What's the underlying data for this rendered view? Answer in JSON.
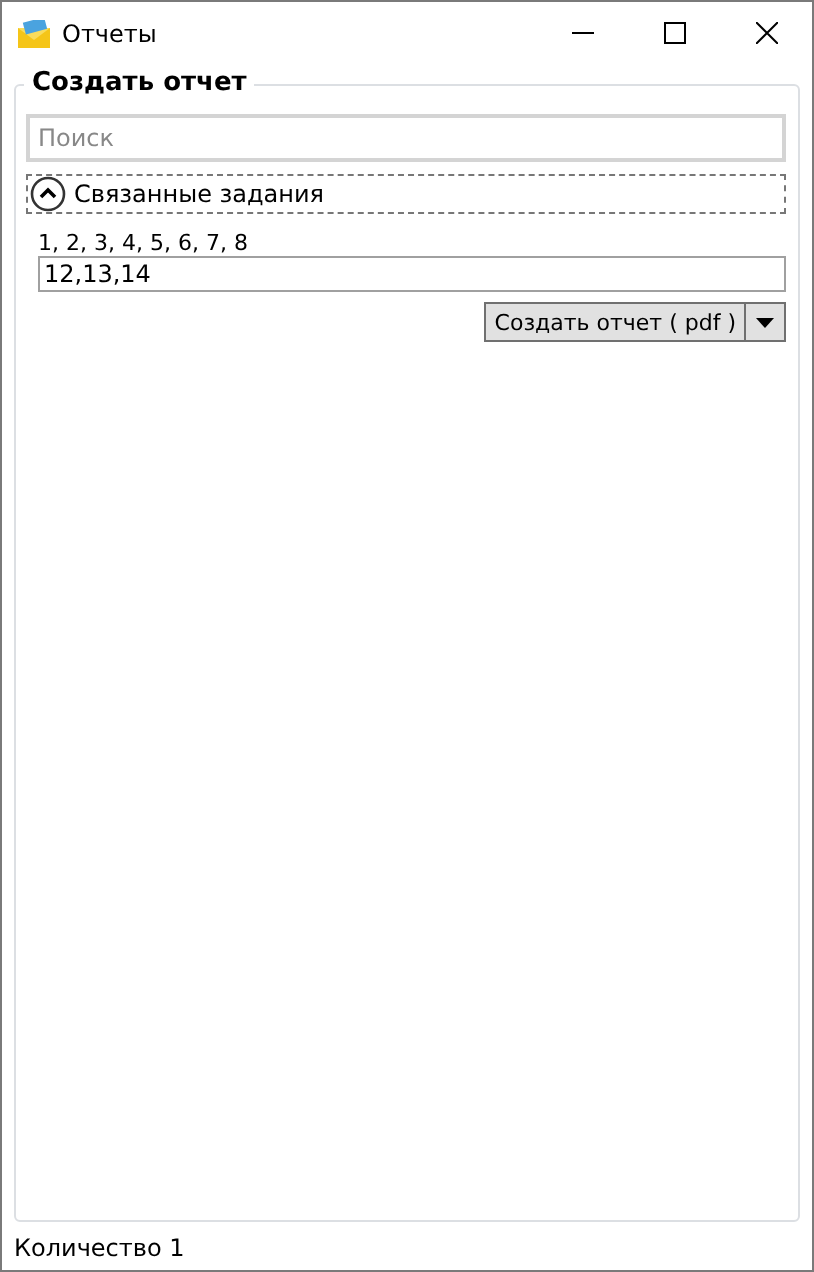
{
  "window": {
    "title": "Отчеты"
  },
  "group": {
    "title": "Создать отчет",
    "search": {
      "placeholder": "Поиск"
    },
    "expander": {
      "label": "Связанные задания",
      "expanded": true,
      "list_text": "1, 2, 3, 4, 5, 6, 7, 8",
      "field_value": "12,13,14"
    },
    "button": {
      "label": "Создать отчет ( pdf )"
    }
  },
  "status_bar": {
    "text": "Количество 1"
  }
}
